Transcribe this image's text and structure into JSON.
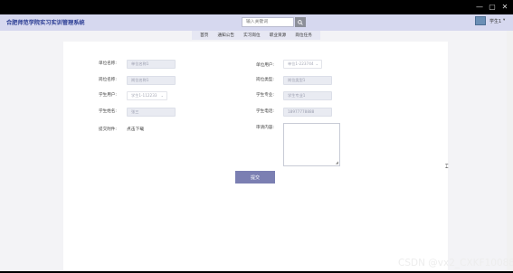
{
  "window": {
    "minimize_glyph": "—",
    "maximize_glyph": "▢",
    "close_glyph": "✕"
  },
  "header": {
    "brand": "合肥师范学院实习实训管理系统",
    "search_placeholder": "输入关键词",
    "user_name": "学生1",
    "user_caret": "▾"
  },
  "nav": {
    "items": [
      "首页",
      "通知公告",
      "实习岗位",
      "职业资源",
      "岗位任务"
    ]
  },
  "form": {
    "fields": {
      "unit_name_label": "单位名称:",
      "unit_name_value": "单位名称1",
      "unit_account_label": "单位用户:",
      "unit_account_value": "单位1-223744",
      "post_name_label": "岗位名称:",
      "post_name_value": "岗位名称1",
      "post_type_label": "岗位类型:",
      "post_type_value": "岗位类型1",
      "student_account_label": "学生用户:",
      "student_account_value": "学生1-112233",
      "student_major_label": "学生专业:",
      "student_major_value": "学生专业1",
      "student_name_label": "学生姓名:",
      "student_name_value": "张三",
      "student_phone_label": "学生电话:",
      "student_phone_value": "18977778888",
      "attachment_label": "提交附件:",
      "attachment_link": "点击下载",
      "review_label": "审请内容:"
    },
    "submit_label": "提交",
    "select_caret": "⌄",
    "resize_glyph": "◢"
  },
  "watermark": "CSDN @vx2_CXKF10088",
  "colors": {
    "header_bg": "#d6d8ef",
    "brand": "#2a3c93",
    "submit_bg": "#7b7fb2"
  }
}
